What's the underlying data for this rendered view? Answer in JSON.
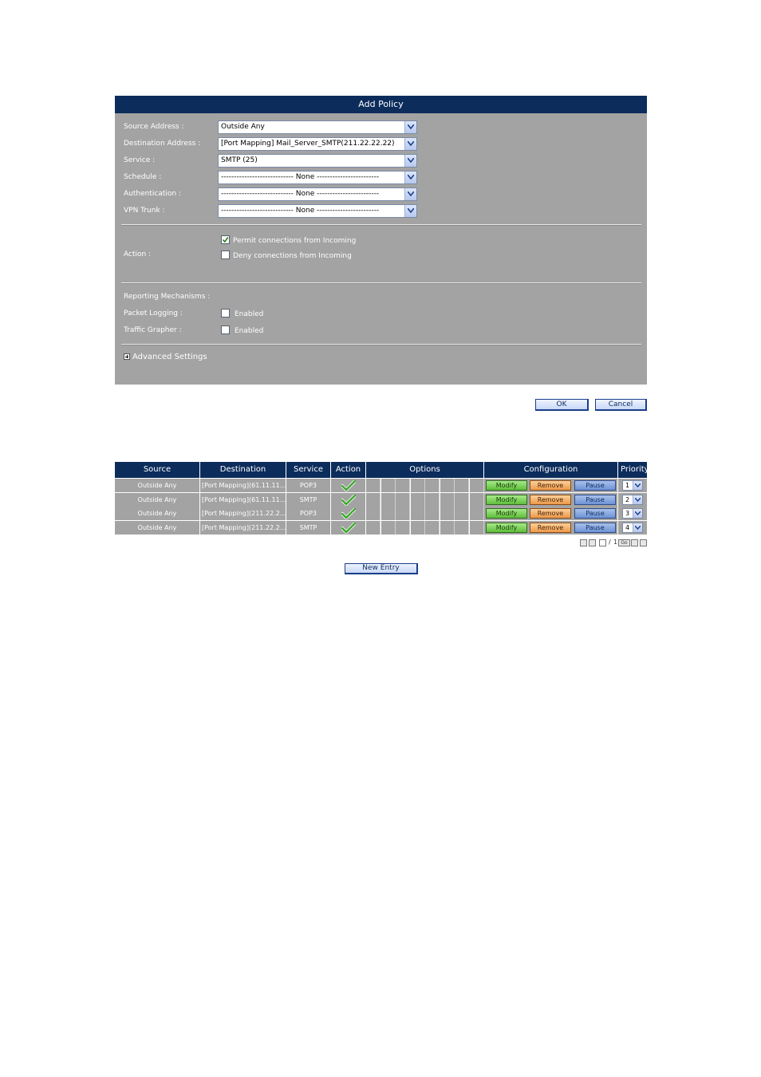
{
  "dialog": {
    "title": "Add Policy",
    "fields": [
      {
        "label": "Source Address :",
        "value": "Outside Any"
      },
      {
        "label": "Destination Address :",
        "value": "[Port Mapping] Mail_Server_SMTP(211.22.22.22)"
      },
      {
        "label": "Service :",
        "value": "SMTP (25)"
      },
      {
        "label": "Schedule :",
        "value": "---------------------------- None ------------------------"
      },
      {
        "label": "Authentication :",
        "value": "---------------------------- None ------------------------"
      },
      {
        "label": "VPN Trunk :",
        "value": "---------------------------- None ------------------------"
      }
    ],
    "action_label": "Action :",
    "permit_label": "Permit connections from Incoming",
    "deny_label": "Deny connections from Incoming",
    "permit_checked": true,
    "deny_checked": false,
    "reporting_label": "Reporting Mechanisms :",
    "packet_logging_label": "Packet Logging :",
    "packet_logging_value": "Enabled",
    "traffic_grapher_label": "Traffic Grapher :",
    "traffic_grapher_value": "Enabled",
    "advanced_label": "Advanced Settings",
    "ok_label": "OK",
    "cancel_label": "Cancel"
  },
  "table": {
    "headers": {
      "source": "Source",
      "destination": "Destination",
      "service": "Service",
      "action": "Action",
      "options": "Options",
      "configuration": "Configuration",
      "priority": "Priority"
    },
    "buttons": {
      "modify": "Modify",
      "remove": "Remove",
      "pause": "Pause"
    },
    "rows": [
      {
        "source": "Outside Any",
        "destination": "[Port Mapping](61.11.11....",
        "service": "POP3",
        "priority": "1"
      },
      {
        "source": "Outside Any",
        "destination": "[Port Mapping](61.11.11....",
        "service": "SMTP",
        "priority": "2"
      },
      {
        "source": "Outside Any",
        "destination": "[Port Mapping](211.22.2...",
        "service": "POP3",
        "priority": "3"
      },
      {
        "source": "Outside Any",
        "destination": "[Port Mapping](211.22.2...",
        "service": "SMTP",
        "priority": "4"
      }
    ],
    "pager": {
      "separator": "/",
      "total": "1",
      "go": "Go"
    },
    "new_entry_label": "New Entry"
  },
  "colors": {
    "header_navy": "#0c2c5c",
    "panel_gray": "#a3a3a3",
    "modify_green": "#5fbf3a",
    "remove_orange": "#ec9a4a",
    "pause_blue": "#6f93d6"
  },
  "icons": {
    "action_allow": "green-check-icon",
    "dropdown": "chevron-down-icon",
    "expand": "plus-icon"
  }
}
